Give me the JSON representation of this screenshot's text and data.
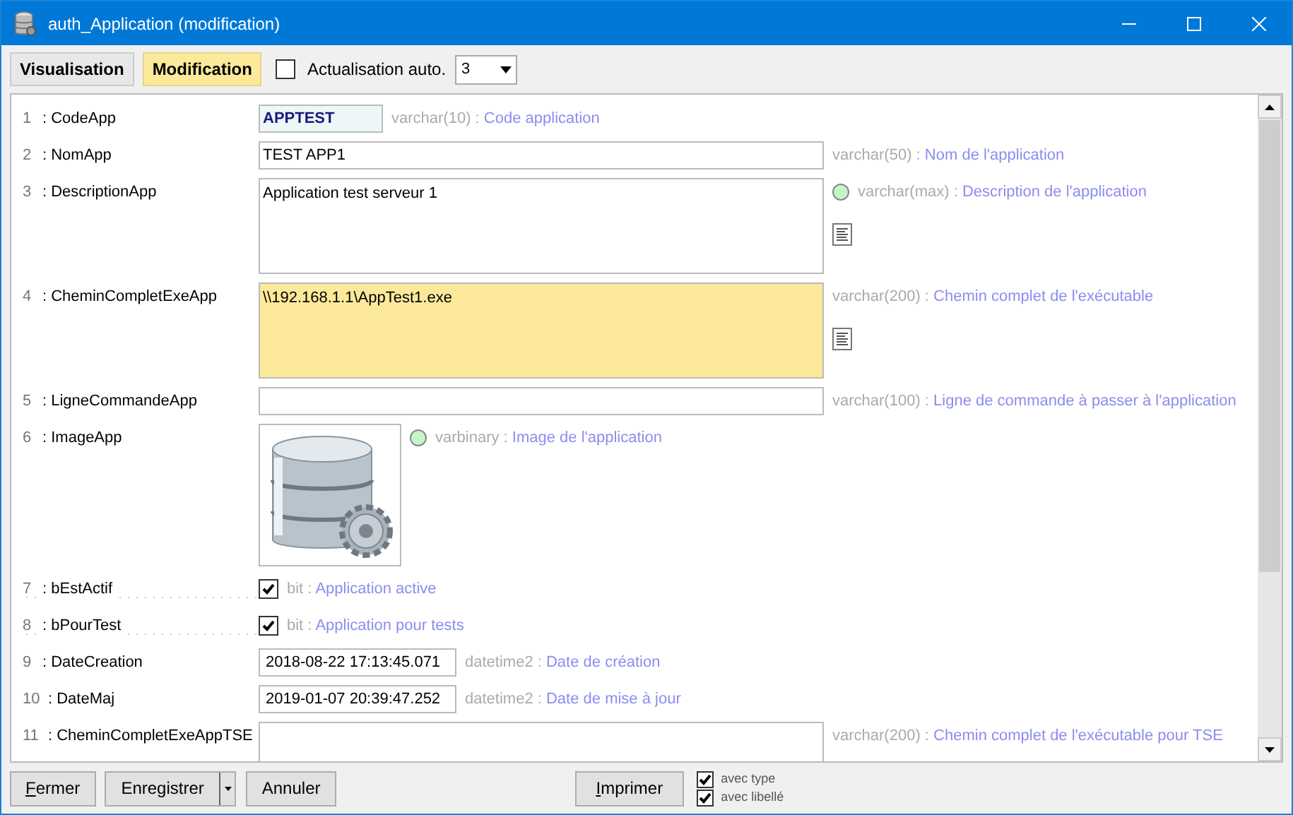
{
  "window": {
    "title": "auth_Application (modification)"
  },
  "toolbar": {
    "modes": [
      {
        "label": "Visualisation",
        "selected": false
      },
      {
        "label": "Modification",
        "selected": true
      }
    ],
    "auto_refresh": {
      "label": "Actualisation auto.",
      "checked": false
    },
    "interval": {
      "value": "3"
    }
  },
  "fields": [
    {
      "kind": "code",
      "number": "1",
      "label": ": CodeApp",
      "value": "APPTEST",
      "type": "varchar(10) :",
      "description": "Code application"
    },
    {
      "kind": "text",
      "number": "2",
      "label": ": NomApp",
      "value": "TEST APP1",
      "type": "varchar(50) :",
      "description": "Nom de l'application"
    },
    {
      "kind": "textarea",
      "number": "3",
      "label": ": DescriptionApp",
      "value": "Application test serveur 1",
      "type": "varchar(max) :",
      "description": "Description de l'application",
      "indicator": true,
      "editor_icon": true
    },
    {
      "kind": "textarea",
      "number": "4",
      "label": ": CheminCompletExeApp",
      "value": "\\\\192.168.1.1\\AppTest1.exe",
      "type": "varchar(200) :",
      "description": "Chemin complet de l'exécutable",
      "highlighted": true,
      "editor_icon": true
    },
    {
      "kind": "text",
      "number": "5",
      "label": ": LigneCommandeApp",
      "type": "varchar(100) :",
      "description": "Ligne de commande à passer à l'application"
    },
    {
      "kind": "image",
      "number": "6",
      "label": ": ImageApp",
      "type": "varbinary :",
      "description": "Image de l'application",
      "indicator": true
    },
    {
      "kind": "checkbox",
      "number": "7",
      "label": ": bEstActif",
      "checked": true,
      "type": "bit :",
      "description": "Application active"
    },
    {
      "kind": "checkbox",
      "number": "8",
      "label": ": bPourTest",
      "checked": true,
      "type": "bit :",
      "description": "Application pour tests"
    },
    {
      "kind": "datetime",
      "number": "9",
      "label": ": DateCreation",
      "value": "2018-08-22 17:13:45.071",
      "type": "datetime2 :",
      "description": "Date de création"
    },
    {
      "kind": "datetime",
      "number": "10",
      "label": ": DateMaj",
      "value": "2019-01-07 20:39:47.252",
      "type": "datetime2 :",
      "description": "Date de mise à jour"
    },
    {
      "kind": "textarea",
      "number": "11",
      "label": ": CheminCompletExeAppTSE",
      "type": "varchar(200) :",
      "description": "Chemin complet de l'exécutable pour TSE"
    }
  ],
  "footer": {
    "buttons": [
      {
        "kind": "plain",
        "label": "Fermer",
        "underline_first": true
      },
      {
        "kind": "split",
        "label": "Enregistrer",
        "underline_first": false
      },
      {
        "kind": "plain",
        "label": "Annuler",
        "underline_first": false
      },
      {
        "kind": "print",
        "label": "Imprimer",
        "underline_first": true
      }
    ],
    "options": [
      {
        "label": "avec type",
        "checked": true
      },
      {
        "label": "avec libellé",
        "checked": true
      }
    ]
  }
}
